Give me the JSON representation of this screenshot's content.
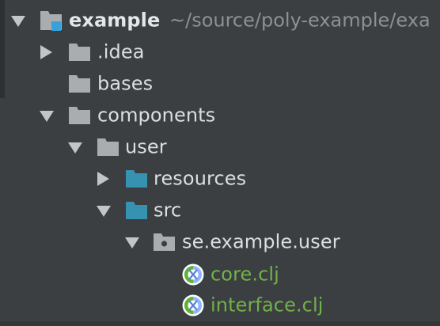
{
  "tree": {
    "root": {
      "name": "example",
      "path": "~/source/poly-example/exa",
      "expanded": true,
      "icon": "module-folder-icon"
    },
    "items": [
      {
        "name": ".idea",
        "expanded": false,
        "icon": "folder-icon"
      },
      {
        "name": "bases",
        "icon": "folder-icon"
      },
      {
        "name": "components",
        "expanded": true,
        "icon": "folder-icon"
      },
      {
        "name": "user",
        "expanded": true,
        "icon": "folder-icon"
      },
      {
        "name": "resources",
        "expanded": false,
        "icon": "resources-folder-icon"
      },
      {
        "name": "src",
        "expanded": true,
        "icon": "source-folder-icon"
      },
      {
        "name": "se.example.user",
        "expanded": true,
        "icon": "package-icon"
      },
      {
        "name": "core.clj",
        "icon": "clojure-file-icon"
      },
      {
        "name": "interface.clj",
        "icon": "clojure-file-icon"
      }
    ]
  },
  "colors": {
    "background": "#3c3f41",
    "text": "#dcdfe2",
    "path_hint": "#8c9194",
    "clj_file_text": "#72b14a",
    "folder_gray": "#a9adb0",
    "folder_teal": "#3592b1",
    "module_badge": "#3aa0d8"
  }
}
